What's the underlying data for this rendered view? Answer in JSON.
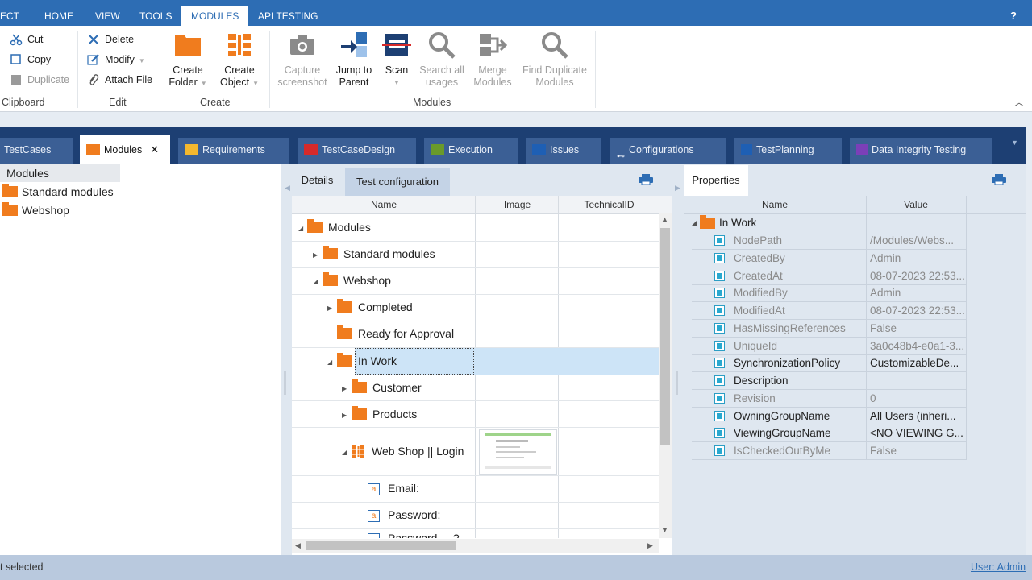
{
  "menu": {
    "items": [
      "ECT",
      "HOME",
      "VIEW",
      "TOOLS",
      "MODULES",
      "API TESTING"
    ],
    "help": "?"
  },
  "ribbon": {
    "clipboard": {
      "cut": "Cut",
      "copy": "Copy",
      "duplicate": "Duplicate",
      "label": "Clipboard"
    },
    "edit": {
      "delete": "Delete",
      "modify": "Modify",
      "attach": "Attach File",
      "label": "Edit"
    },
    "create": {
      "folder_l1": "Create",
      "folder_l2": "Folder",
      "object_l1": "Create",
      "object_l2": "Object",
      "label": "Create"
    },
    "modules": {
      "capture_l1": "Capture",
      "capture_l2": "screenshot",
      "jump_l1": "Jump to",
      "jump_l2": "Parent",
      "scan": "Scan",
      "search_l1": "Search all",
      "search_l2": "usages",
      "merge_l1": "Merge",
      "merge_l2": "Modules",
      "dup_l1": "Find Duplicate",
      "dup_l2": "Modules",
      "label": "Modules"
    }
  },
  "tabs": [
    {
      "label": "TestCases",
      "color": ""
    },
    {
      "label": "Modules",
      "color": "#f07c1e",
      "active": true
    },
    {
      "label": "Requirements",
      "color": "#f5b82e"
    },
    {
      "label": "TestCaseDesign",
      "color": "#d62a2a"
    },
    {
      "label": "Execution",
      "color": "#6a9a2a"
    },
    {
      "label": "Issues",
      "color": "#1e5fb4"
    },
    {
      "label": "Configurations",
      "color": ""
    },
    {
      "label": "TestPlanning",
      "color": "#1e5fb4"
    },
    {
      "label": "Data Integrity Testing",
      "color": "#7b3fb8"
    }
  ],
  "left_tree": {
    "root": "Modules",
    "items": [
      "Standard modules",
      "Webshop"
    ]
  },
  "details": {
    "tab_details": "Details",
    "tab_config": "Test configuration",
    "columns": [
      "Name",
      "Image",
      "TechnicalID"
    ],
    "rows": [
      "Modules",
      "Standard modules",
      "Webshop",
      "Completed",
      "Ready for Approval",
      "In Work",
      "Customer",
      "Products",
      "Web Shop || Login",
      "Email:",
      "Password:",
      "Password ... ?"
    ]
  },
  "properties": {
    "tab": "Properties",
    "columns": [
      "Name",
      "Value"
    ],
    "root": "In Work",
    "rows": [
      {
        "name": "NodePath",
        "value": "/Modules/Webs...",
        "dim": true
      },
      {
        "name": "CreatedBy",
        "value": "Admin",
        "dim": true
      },
      {
        "name": "CreatedAt",
        "value": "08-07-2023 22:53...",
        "dim": true
      },
      {
        "name": "ModifiedBy",
        "value": "Admin",
        "dim": true
      },
      {
        "name": "ModifiedAt",
        "value": "08-07-2023 22:53...",
        "dim": true
      },
      {
        "name": "HasMissingReferences",
        "value": "False",
        "dim": true
      },
      {
        "name": "UniqueId",
        "value": "3a0c48b4-e0a1-3...",
        "dim": true
      },
      {
        "name": "SynchronizationPolicy",
        "value": "CustomizableDe...",
        "dim": false
      },
      {
        "name": "Description",
        "value": "",
        "dim": false
      },
      {
        "name": "Revision",
        "value": "0",
        "dim": true
      },
      {
        "name": "OwningGroupName",
        "value": "All Users (inheri...",
        "dim": false
      },
      {
        "name": "ViewingGroupName",
        "value": "<NO VIEWING G...",
        "dim": false
      },
      {
        "name": "IsCheckedOutByMe",
        "value": "False",
        "dim": true
      }
    ]
  },
  "status": {
    "left": "t selected",
    "right": "User: Admin"
  }
}
